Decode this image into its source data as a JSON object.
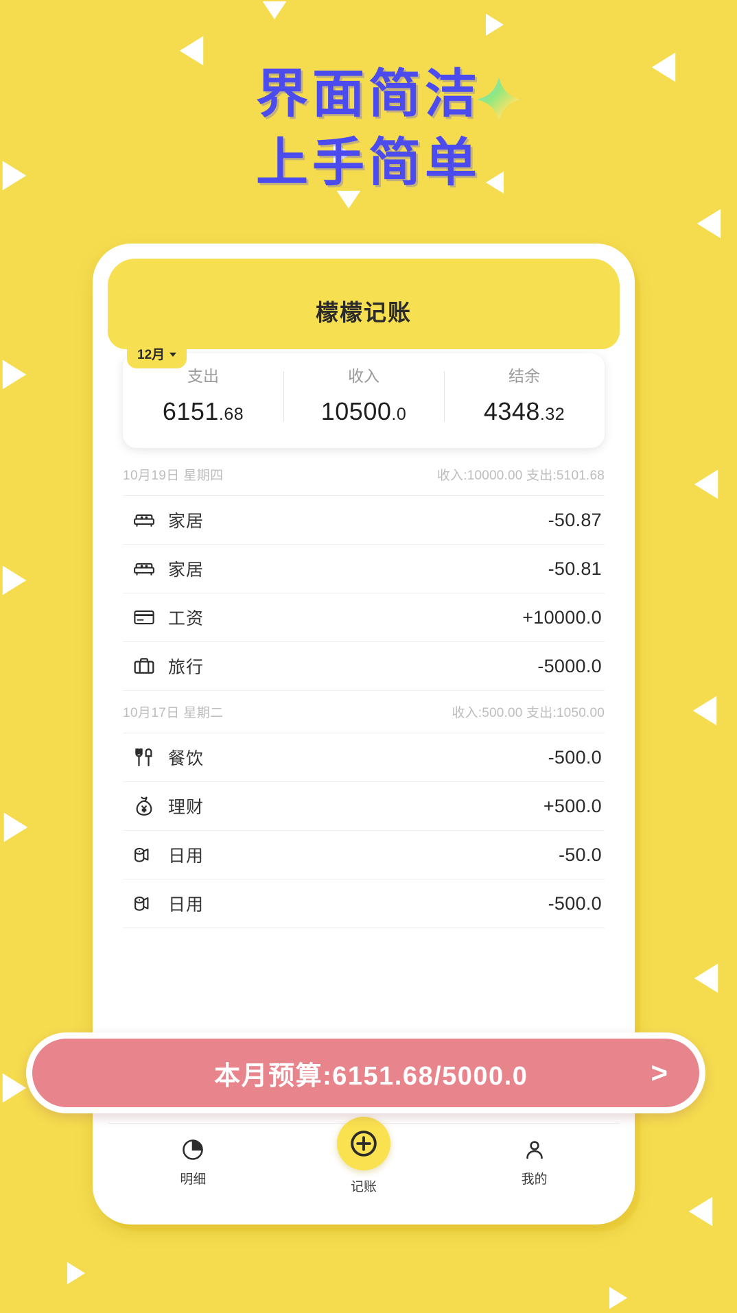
{
  "promo": {
    "headline_line1": "界面简洁",
    "headline_line2": "上手简单",
    "sparkle_icon": "sparkle-star-icon",
    "bg_color": "#F5DC4E",
    "headline_color": "#4B4BEE"
  },
  "app": {
    "title": "檬檬记账",
    "header_color": "#F7DF52"
  },
  "summary": {
    "month_chip": "12月",
    "caret_icon": "chevron-down-icon",
    "columns": [
      {
        "label": "支出",
        "int": "6151",
        "dec": ".68"
      },
      {
        "label": "收入",
        "int": "10500",
        "dec": ".0"
      },
      {
        "label": "结余",
        "int": "4348",
        "dec": ".32"
      }
    ]
  },
  "groups": [
    {
      "date": "10月19日 星期四",
      "totals": "收入:10000.00 支出:5101.68",
      "rows": [
        {
          "icon": "sofa-icon",
          "name": "家居",
          "amount": "-50.87"
        },
        {
          "icon": "sofa-icon",
          "name": "家居",
          "amount": "-50.81"
        },
        {
          "icon": "credit-card-icon",
          "name": "工资",
          "amount": "+10000.0"
        },
        {
          "icon": "suitcase-icon",
          "name": "旅行",
          "amount": "-5000.0"
        }
      ]
    },
    {
      "date": "10月17日 星期二",
      "totals": "收入:500.00 支出:1050.00",
      "rows": [
        {
          "icon": "fork-knife-icon",
          "name": "餐饮",
          "amount": "-500.0"
        },
        {
          "icon": "money-bag-icon",
          "name": "理财",
          "amount": "+500.0"
        },
        {
          "icon": "toilet-paper-icon",
          "name": "日用",
          "amount": "-50.0"
        },
        {
          "icon": "toilet-paper-icon",
          "name": "日用",
          "amount": "-500.0"
        }
      ]
    }
  ],
  "budget": {
    "text": "本月预算:6151.68/5000.0",
    "arrow": ">",
    "color": "#E8848B"
  },
  "nav": {
    "items": [
      {
        "icon": "pie-chart-icon",
        "label": "明细"
      },
      {
        "icon": "plus-circle-icon",
        "label": "记账"
      },
      {
        "icon": "person-icon",
        "label": "我的"
      }
    ]
  }
}
